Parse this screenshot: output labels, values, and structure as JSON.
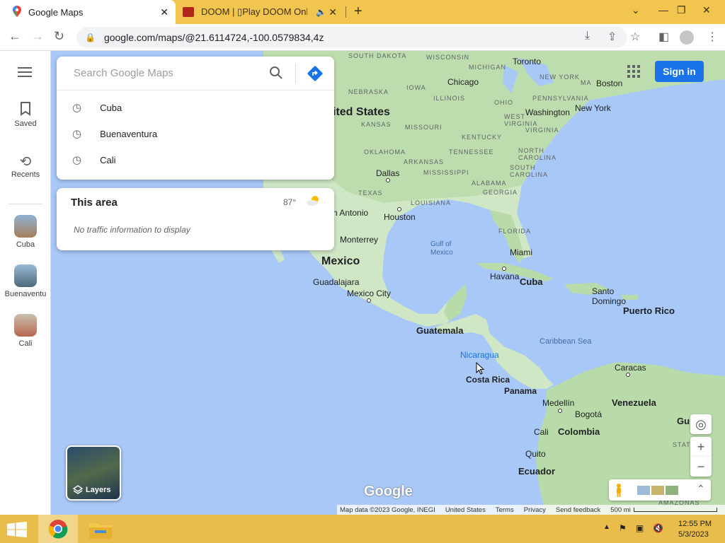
{
  "browser": {
    "tabs": [
      {
        "title": "Google Maps",
        "icon": "maps-pin-icon"
      },
      {
        "title": "DOOM | ▯Play DOOM Onlin",
        "icon": "doom-icon"
      }
    ],
    "url": "google.com/maps/@21.6114724,-100.0579834,4z",
    "accent_color": "#f2c54f"
  },
  "sidebar": {
    "items": [
      {
        "label": "Saved"
      },
      {
        "label": "Recents"
      },
      {
        "label": "Cuba"
      },
      {
        "label": "Buenaventu"
      },
      {
        "label": "Cali"
      }
    ]
  },
  "search": {
    "placeholder": "Search Google Maps",
    "recents": [
      "Cuba",
      "Buenaventura",
      "Cali"
    ]
  },
  "area_card": {
    "title": "This area",
    "temperature": "87°",
    "traffic_text": "No traffic information to display"
  },
  "map": {
    "sign_in_label": "Sign in",
    "layers_label": "Layers",
    "attribution": [
      "Map data ©2023 Google, INEGI",
      "United States",
      "Terms",
      "Privacy",
      "Send feedback",
      "500 mi"
    ],
    "labels": {
      "south_dakota": "SOUTH\nDAKOTA",
      "wisconsin": "WISCONSIN",
      "michigan": "MICHIGAN",
      "toronto": "Toronto",
      "new_york_state": "NEW YORK",
      "boston": "Boston",
      "mass": "MA",
      "nebraska": "NEBRASKA",
      "iowa": "IOWA",
      "chicago": "Chicago",
      "illinois": "ILLINOIS",
      "ohio": "OHIO",
      "pennsylvania": "PENNSYLVANIA",
      "united_states": "ited States",
      "washington": "Washington",
      "new_york_city": "New York",
      "kansas": "KANSAS",
      "missouri": "MISSOURI",
      "west_virginia": "WEST\nVIRGINIA",
      "virginia": "VIRGINIA",
      "kentucky": "KENTUCKY",
      "oklahoma": "OKLAHOMA",
      "tennessee": "TENNESSEE",
      "north_carolina": "NORTH\nCAROLINA",
      "arkansas": "ARKANSAS",
      "south_carolina": "SOUTH\nCAROLINA",
      "dallas": "Dallas",
      "mississippi": "MISSISSIPPI",
      "alabama": "ALABAMA",
      "georgia": "GEORGIA",
      "texas": "TEXAS",
      "louisiana": "LOUISIANA",
      "san_antonio": "n Antonio",
      "houston": "Houston",
      "florida": "FLORIDA",
      "gulf": "Gulf of\nMexico",
      "monterrey": "Monterrey",
      "miami": "Miami",
      "mexico": "Mexico",
      "havana": "Havana",
      "cuba": "Cuba",
      "guadalajara": "Guadalajara",
      "mexico_city": "Mexico City",
      "santo_domingo": "Santo\nDomingo",
      "puerto_rico": "Puerto Rico",
      "guatemala": "Guatemala",
      "caribbean": "Caribbean Sea",
      "nicaragua": "Nicaragua",
      "caracas": "Caracas",
      "costa_rica": "Costa Rica",
      "panama": "Panama",
      "medellin": "Medellín",
      "venezuela": "Venezuela",
      "bogota": "Bogotá",
      "cali": "Cali",
      "colombia": "Colombia",
      "quito": "Quito",
      "ecuador": "Ecuador",
      "guy": "Gu",
      "amazonas": "AMAZONAS",
      "state_of": "STATE OF",
      "google_logo": "Google"
    }
  },
  "taskbar": {
    "time": "12:55 PM",
    "date": "5/3/2023"
  }
}
